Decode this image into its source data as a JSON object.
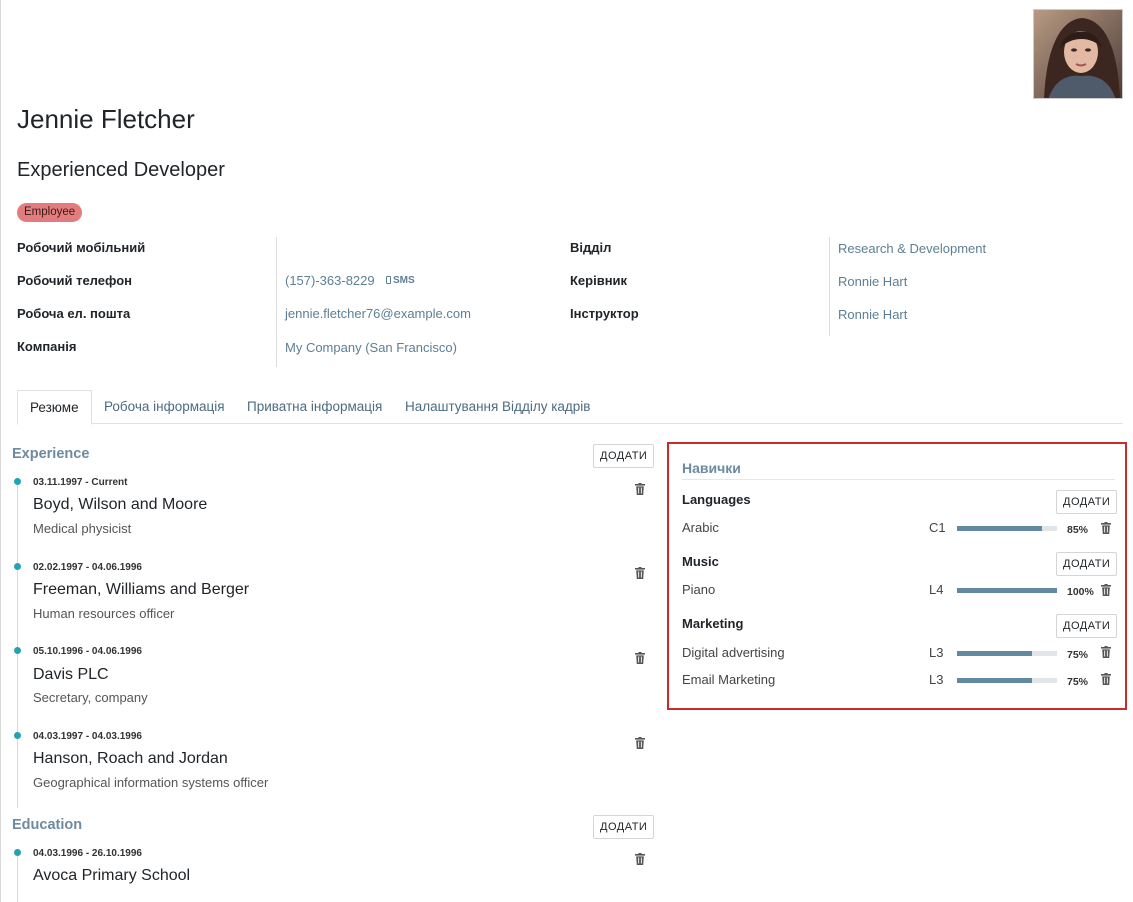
{
  "employee": {
    "name": "Jennie Fletcher",
    "job_title": "Experienced Developer",
    "tag": "Employee"
  },
  "fields": {
    "work_mobile_label": "Робочий мобільний",
    "work_phone_label": "Робочий телефон",
    "work_phone_value": "(157)-363-8229",
    "sms_label": "SMS",
    "work_email_label": "Робоча ел. пошта",
    "work_email_value": "jennie.fletcher76@example.com",
    "company_label": "Компанія",
    "company_value": "My Company (San Francisco)",
    "department_label": "Відділ",
    "department_value": "Research & Development",
    "manager_label": "Керівник",
    "manager_value": "Ronnie Hart",
    "coach_label": "Інструктор",
    "coach_value": "Ronnie Hart"
  },
  "tabs": [
    {
      "label": "Резюме",
      "active": true
    },
    {
      "label": "Робоча інформація",
      "active": false
    },
    {
      "label": "Приватна інформація",
      "active": false
    },
    {
      "label": "Налаштування Відділу кадрів",
      "active": false
    }
  ],
  "resume": {
    "add_label": "ДОДАТИ",
    "experience_title": "Experience",
    "experience": [
      {
        "date": "03.11.1997 - Current",
        "title": "Boyd, Wilson and Moore",
        "desc": "Medical physicist"
      },
      {
        "date": "02.02.1997 - 04.06.1996",
        "title": "Freeman, Williams and Berger",
        "desc": "Human resources officer"
      },
      {
        "date": "05.10.1996 - 04.06.1996",
        "title": "Davis PLC",
        "desc": "Secretary, company"
      },
      {
        "date": "04.03.1997 - 04.03.1996",
        "title": "Hanson, Roach and Jordan",
        "desc": "Geographical information systems officer"
      }
    ],
    "education_title": "Education",
    "education": [
      {
        "date": "04.03.1996 - 26.10.1996",
        "title": "Avoca Primary School"
      }
    ]
  },
  "skills": {
    "title": "Навички",
    "add_label": "ДОДАТИ",
    "groups": [
      {
        "type": "Languages",
        "items": [
          {
            "name": "Arabic",
            "level": "C1",
            "progress": 85,
            "pct_label": "85%"
          }
        ]
      },
      {
        "type": "Music",
        "items": [
          {
            "name": "Piano",
            "level": "L4",
            "progress": 100,
            "pct_label": "100%"
          }
        ]
      },
      {
        "type": "Marketing",
        "items": [
          {
            "name": "Digital advertising",
            "level": "L3",
            "progress": 75,
            "pct_label": "75%"
          },
          {
            "name": "Email Marketing",
            "level": "L3",
            "progress": 75,
            "pct_label": "75%"
          }
        ]
      }
    ]
  },
  "colors": {
    "accent": "#5d7f94",
    "tag_bg": "#e37c7c",
    "timeline_dot": "#21a3b3",
    "highlight_border": "#cc2b2b",
    "progress_fill": "#6189a2"
  }
}
